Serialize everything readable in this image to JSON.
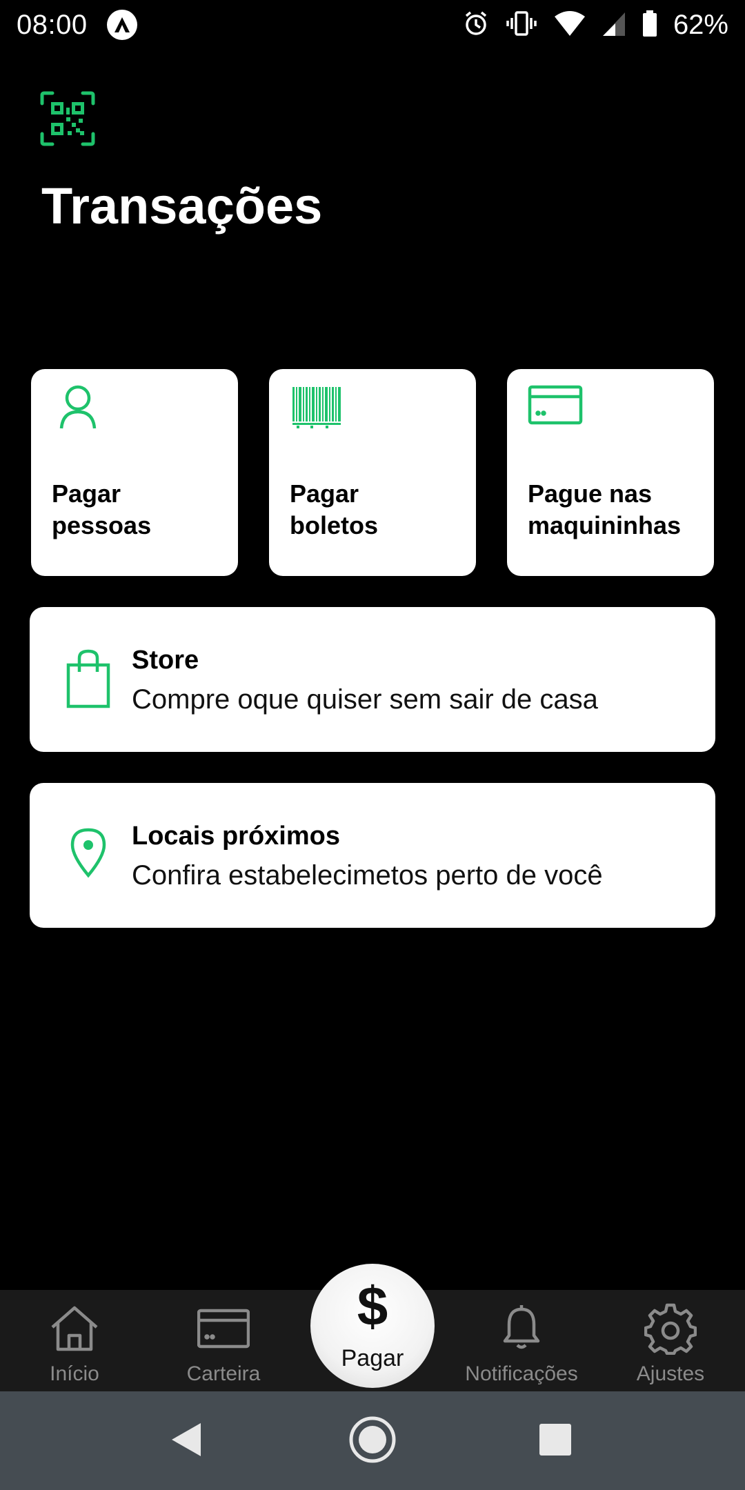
{
  "status_bar": {
    "time": "08:00",
    "battery": "62%",
    "icons": [
      "app-notification-icon",
      "alarm-icon",
      "vibrate-icon",
      "wifi-icon",
      "cell-signal-icon",
      "battery-icon"
    ]
  },
  "header": {
    "qr_icon": "qr-code-scan-icon",
    "title": "Transações"
  },
  "tiles": [
    {
      "icon": "person-icon",
      "label_line1": "Pagar",
      "label_line2": "pessoas"
    },
    {
      "icon": "barcode-icon",
      "label_line1": "Pagar",
      "label_line2": "boletos"
    },
    {
      "icon": "card-icon",
      "label_line1": "Pague nas",
      "label_line2": "maquininhas"
    }
  ],
  "cards": {
    "store": {
      "icon": "shopping-bag-icon",
      "title": "Store",
      "subtitle": "Compre oque quiser sem sair de casa"
    },
    "locais": {
      "icon": "location-pin-icon",
      "title": "Locais próximos",
      "subtitle": "Confira estabelecimetos perto de você"
    }
  },
  "bottom_nav": {
    "inicio": "Início",
    "carteira": "Carteira",
    "pagar_symbol": "$",
    "pagar": "Pagar",
    "notificacoes": "Notificações",
    "ajustes": "Ajustes"
  },
  "colors": {
    "accent": "#1ec26b",
    "background": "#000000",
    "nav_background": "#1a1a1a",
    "system_nav": "#454c52"
  }
}
